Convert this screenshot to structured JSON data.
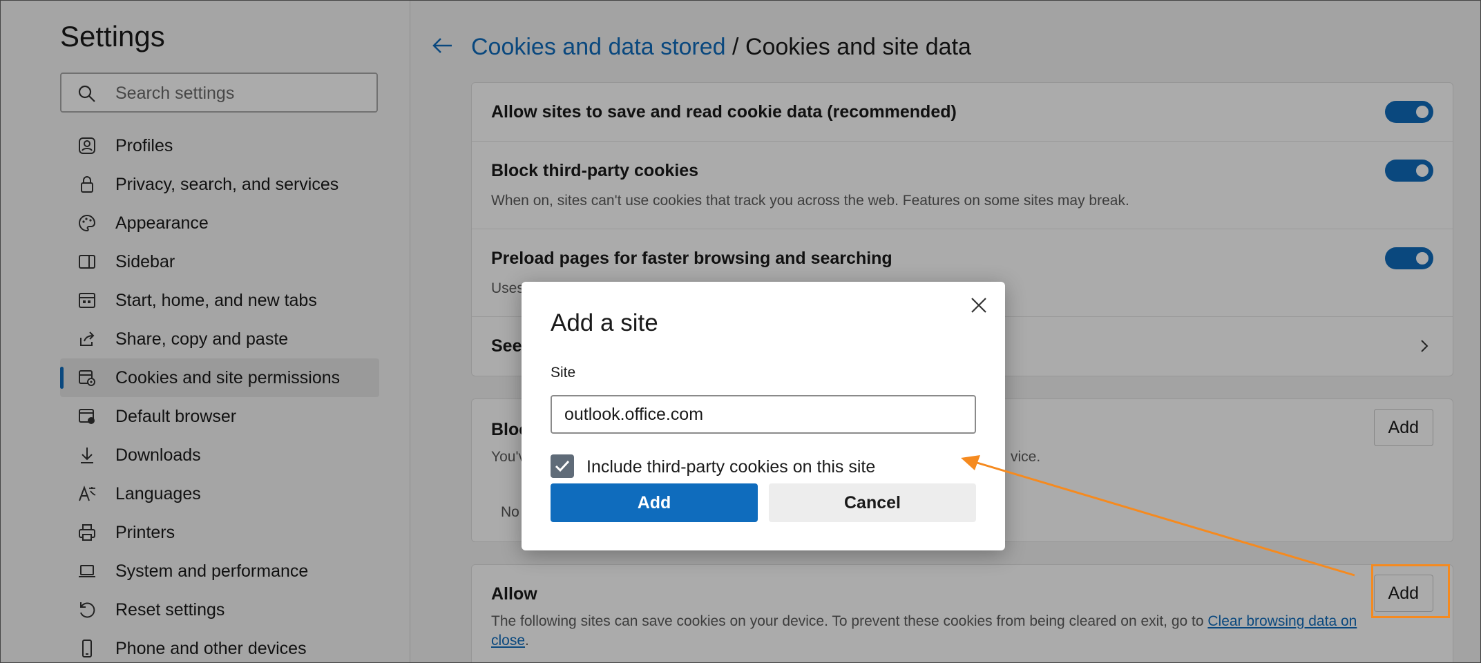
{
  "sidebar": {
    "title": "Settings",
    "search_placeholder": "Search settings",
    "items": [
      {
        "label": "Profiles",
        "icon": "profile-icon"
      },
      {
        "label": "Privacy, search, and services",
        "icon": "lock-icon"
      },
      {
        "label": "Appearance",
        "icon": "palette-icon"
      },
      {
        "label": "Sidebar",
        "icon": "sidebar-icon"
      },
      {
        "label": "Start, home, and new tabs",
        "icon": "home-tabs-icon"
      },
      {
        "label": "Share, copy and paste",
        "icon": "share-icon"
      },
      {
        "label": "Cookies and site permissions",
        "icon": "cookie-permissions-icon",
        "active": true
      },
      {
        "label": "Default browser",
        "icon": "browser-icon"
      },
      {
        "label": "Downloads",
        "icon": "download-icon"
      },
      {
        "label": "Languages",
        "icon": "language-icon"
      },
      {
        "label": "Printers",
        "icon": "printer-icon"
      },
      {
        "label": "System and performance",
        "icon": "laptop-icon"
      },
      {
        "label": "Reset settings",
        "icon": "reset-icon"
      },
      {
        "label": "Phone and other devices",
        "icon": "phone-icon"
      }
    ]
  },
  "header": {
    "breadcrumb_parent": "Cookies and data stored",
    "breadcrumb_separator": "/",
    "breadcrumb_current": "Cookies and site data"
  },
  "settings": {
    "allow_cookies": {
      "title": "Allow sites to save and read cookie data (recommended)",
      "enabled": true
    },
    "block_third_party": {
      "title": "Block third-party cookies",
      "desc": "When on, sites can't use cookies that track you across the web. Features on some sites may break.",
      "enabled": true
    },
    "preload": {
      "title": "Preload pages for faster browsing and searching",
      "desc_partial": "Uses",
      "enabled": true
    },
    "see_all": {
      "title_partial": "See"
    }
  },
  "block_section": {
    "title_partial": "Bloc",
    "desc_partial_left": "You'v",
    "desc_partial_right": "vice.",
    "empty_partial": "No",
    "add_label": "Add"
  },
  "allow_section": {
    "title": "Allow",
    "desc": "The following sites can save cookies on your device. To prevent these cookies from being cleared on exit, go to ",
    "link_text_1": "Clear browsing data on",
    "link_text_2": "close",
    "desc_end": ".",
    "add_label": "Add"
  },
  "dialog": {
    "title": "Add a site",
    "site_label": "Site",
    "site_value": "outlook.office.com",
    "checkbox_label": "Include third-party cookies on this site",
    "checkbox_checked": true,
    "add_label": "Add",
    "cancel_label": "Cancel"
  },
  "colors": {
    "accent": "#0f6cbd",
    "annotation": "#f58a1f"
  }
}
